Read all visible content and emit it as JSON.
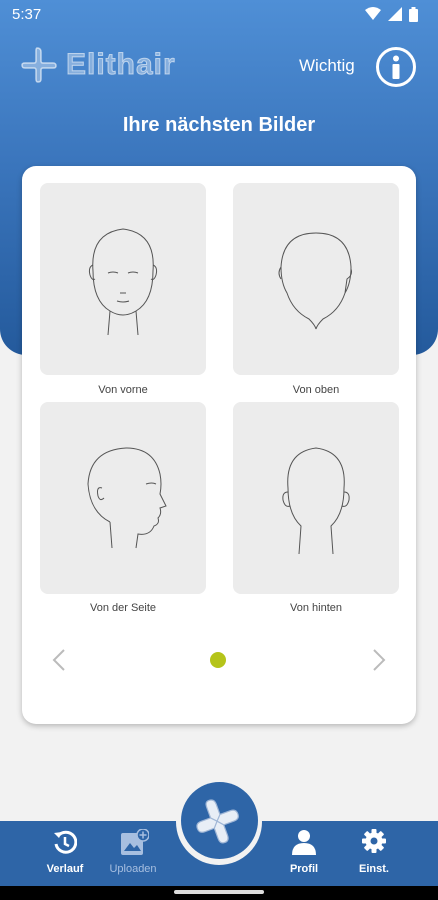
{
  "status_bar": {
    "time": "5:37"
  },
  "header": {
    "logo_text": "Elithair",
    "wichtig_label": "Wichtig",
    "title": "Ihre nächsten Bilder"
  },
  "tiles": [
    {
      "label": "Von vorne",
      "icon": "head-front-icon"
    },
    {
      "label": "Von oben",
      "icon": "head-top-icon"
    },
    {
      "label": "Von der Seite",
      "icon": "head-side-icon"
    },
    {
      "label": "Von hinten",
      "icon": "head-back-icon"
    }
  ],
  "pagination": {
    "current_page": 1,
    "active_color": "#b5c41a"
  },
  "bottom_nav": {
    "items": [
      {
        "label": "Verlauf",
        "icon": "history-icon"
      },
      {
        "label": "Uploaden",
        "icon": "upload-image-icon"
      },
      {
        "label": "Profil",
        "icon": "profile-icon"
      },
      {
        "label": "Einst.",
        "icon": "settings-icon"
      }
    ],
    "center_icon": "elithair-logo-icon"
  },
  "colors": {
    "primary": "#2e65a7",
    "header_top": "#4f8fd6",
    "header_bottom": "#245a9c",
    "accent": "#b5c41a",
    "background": "#f2f2f2"
  }
}
